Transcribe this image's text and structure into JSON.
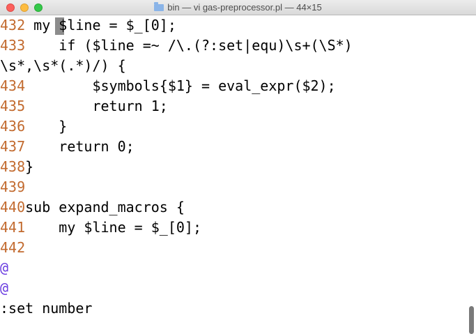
{
  "window": {
    "title": "bin — vi gas-preprocessor.pl — 44×15"
  },
  "editor": {
    "lines": [
      {
        "num": "432",
        "code": " my $line = $_[0];"
      },
      {
        "num": "433",
        "code": "    if ($line =~ /\\.(?:set|equ)\\s+(\\S*)"
      },
      {
        "num": "",
        "code": "\\s*,\\s*(.*)/) {"
      },
      {
        "num": "434",
        "code": "        $symbols{$1} = eval_expr($2);"
      },
      {
        "num": "435",
        "code": "        return 1;"
      },
      {
        "num": "436",
        "code": "    }"
      },
      {
        "num": "437",
        "code": "    return 0;"
      },
      {
        "num": "438",
        "code": "}"
      },
      {
        "num": "439",
        "code": ""
      },
      {
        "num": "440",
        "code": "sub expand_macros {"
      },
      {
        "num": "441",
        "code": "    my $line = $_[0];"
      },
      {
        "num": "442",
        "code": ""
      }
    ],
    "tilde_lines": [
      "@",
      "@"
    ],
    "command_line": ":set number"
  }
}
